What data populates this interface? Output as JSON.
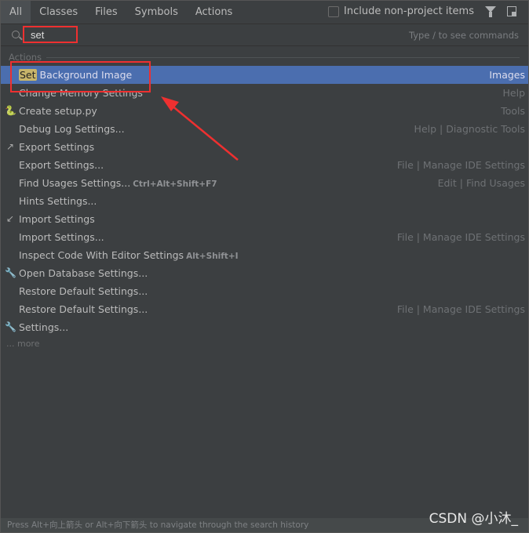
{
  "tabs": [
    "All",
    "Classes",
    "Files",
    "Symbols",
    "Actions"
  ],
  "include_label": "Include non-project items",
  "include_checked": false,
  "search": {
    "value": "set",
    "hint": "Type / to see commands"
  },
  "section": "Actions",
  "rows": [
    {
      "highlight": "Set",
      "label": " Background Image",
      "shortcut": "",
      "category": "Images",
      "icon": "",
      "selected": true
    },
    {
      "highlight": "",
      "label": "Change Memory Settings",
      "shortcut": "",
      "category": "Help",
      "icon": ""
    },
    {
      "highlight": "",
      "label": "Create setup.py",
      "shortcut": "",
      "category": "Tools",
      "icon": "python-file-icon"
    },
    {
      "highlight": "",
      "label": "Debug Log Settings...",
      "shortcut": "",
      "category": "Help | Diagnostic Tools",
      "icon": ""
    },
    {
      "highlight": "",
      "label": "Export Settings",
      "shortcut": "",
      "category": "",
      "icon": "export-icon"
    },
    {
      "highlight": "",
      "label": "Export Settings...",
      "shortcut": "",
      "category": "File | Manage IDE Settings",
      "icon": ""
    },
    {
      "highlight": "",
      "label": "Find Usages Settings...",
      "shortcut": "Ctrl+Alt+Shift+F7",
      "category": "Edit | Find Usages",
      "icon": ""
    },
    {
      "highlight": "",
      "label": "Hints Settings...",
      "shortcut": "",
      "category": "",
      "icon": ""
    },
    {
      "highlight": "",
      "label": "Import Settings",
      "shortcut": "",
      "category": "",
      "icon": "import-icon"
    },
    {
      "highlight": "",
      "label": "Import Settings...",
      "shortcut": "",
      "category": "File | Manage IDE Settings",
      "icon": ""
    },
    {
      "highlight": "",
      "label": "Inspect Code With Editor Settings",
      "shortcut": "Alt+Shift+I",
      "category": "",
      "icon": ""
    },
    {
      "highlight": "",
      "label": "Open Database Settings...",
      "shortcut": "",
      "category": "",
      "icon": "wrench-icon"
    },
    {
      "highlight": "",
      "label": "Restore Default Settings...",
      "shortcut": "",
      "category": "",
      "icon": ""
    },
    {
      "highlight": "",
      "label": "Restore Default Settings...",
      "shortcut": "",
      "category": "File | Manage IDE Settings",
      "icon": ""
    },
    {
      "highlight": "",
      "label": "Settings...",
      "shortcut": "",
      "category": "",
      "icon": "wrench-icon"
    }
  ],
  "more": "... more",
  "status": "Press Alt+向上箭头 or Alt+向下箭头 to navigate through the search history",
  "watermark": "CSDN @小沐_",
  "colors": {
    "selection": "#4b6eaf",
    "highlight": "#c8b56a",
    "annotation": "#ee3030"
  }
}
